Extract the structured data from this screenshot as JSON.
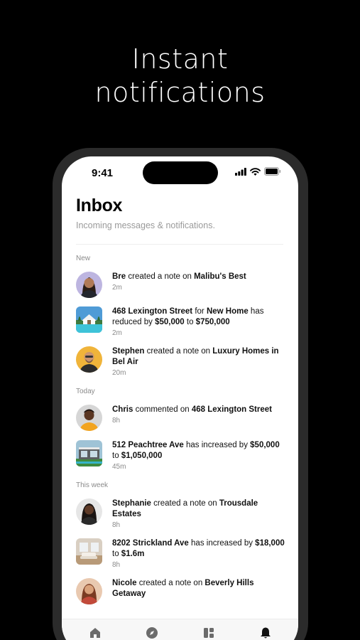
{
  "promo": {
    "headline_line1": "Instant",
    "headline_line2": "notifications"
  },
  "status_bar": {
    "time": "9:41"
  },
  "header": {
    "title": "Inbox",
    "subtitle": "Incoming messages & notifications."
  },
  "sections": {
    "new": "New",
    "today": "Today",
    "this_week": "This week"
  },
  "notifications": [
    {
      "actor": "Bre",
      "action": " created a note on ",
      "target": "Malibu's Best",
      "time": "2m",
      "thumb": "avatar-bre"
    },
    {
      "actor": "468 Lexington Street",
      "action": " for ",
      "target": "New Home",
      "action2": " has reduced by ",
      "amount1": "$50,000",
      "action3": " to ",
      "amount2": "$750,000",
      "time": "2m",
      "thumb": "property-pool"
    },
    {
      "actor": "Stephen",
      "action": " created a note on ",
      "target": "Luxury Homes in Bel Air",
      "time": "20m",
      "thumb": "avatar-stephen"
    },
    {
      "actor": "Chris",
      "action": " commented on ",
      "target": "468 Lexington Street",
      "time": "8h",
      "thumb": "avatar-chris"
    },
    {
      "actor": "512 Peachtree Ave",
      "action": " has increased by ",
      "amount1": "$50,000",
      "action2": " to ",
      "amount2": "$1,050,000",
      "time": "45m",
      "thumb": "property-modern"
    },
    {
      "actor": "Stephanie",
      "action": " created a note on ",
      "target": "Trousdale Estates",
      "time": "8h",
      "thumb": "avatar-stephanie"
    },
    {
      "actor": "8202 Strickland Ave",
      "action": " has increased by ",
      "amount1": "$18,000",
      "action2": " to ",
      "amount2": "$1.6m",
      "time": "8h",
      "thumb": "property-interior"
    },
    {
      "actor": "Nicole",
      "action": " created a note on ",
      "target": "Beverly Hills Getaway",
      "thumb": "avatar-nicole"
    }
  ],
  "tabbar": {
    "items": [
      "home-icon",
      "compass-icon",
      "dashboard-icon",
      "bell-icon"
    ],
    "active": "bell-icon"
  },
  "colors": {
    "background": "#000000",
    "screen": "#ffffff",
    "muted_text": "#8a8a8a"
  }
}
